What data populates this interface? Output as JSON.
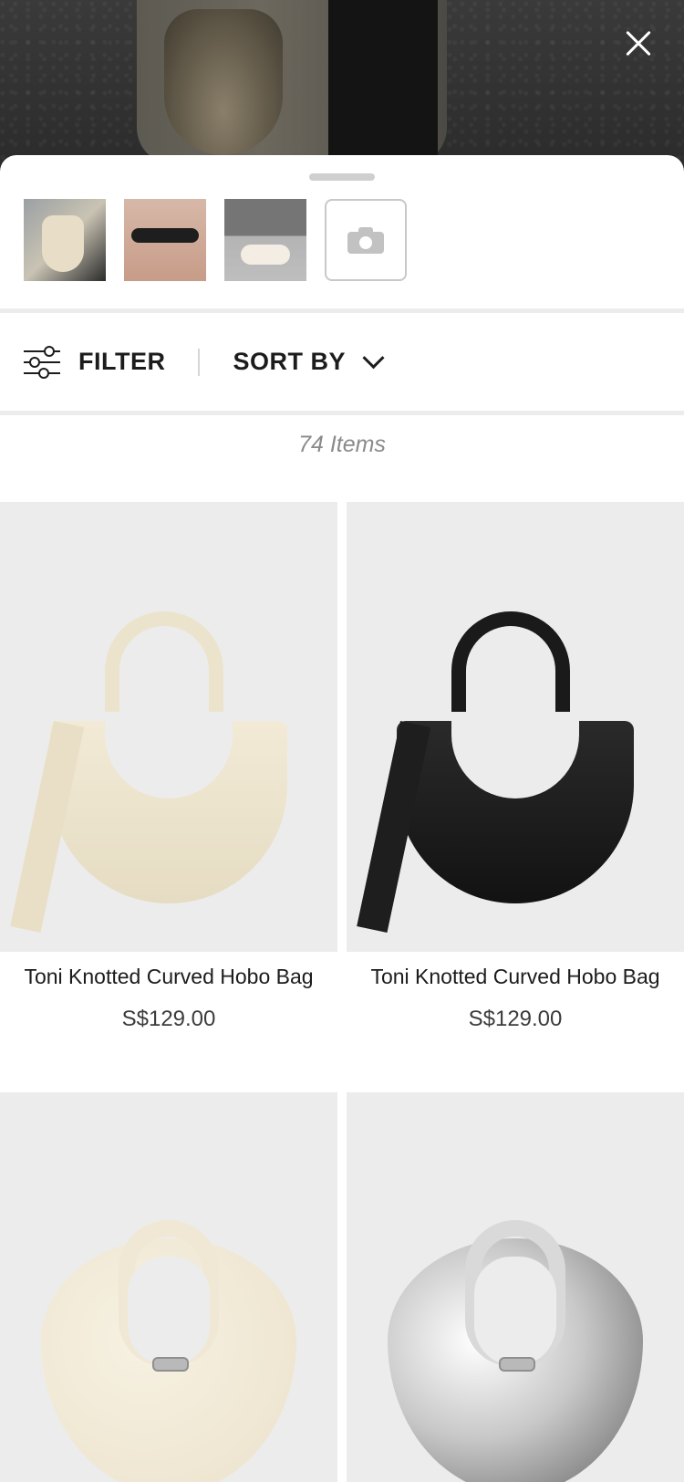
{
  "header": {
    "close_icon": "close-icon"
  },
  "visual_search": {
    "thumbnails": [
      {
        "name": "photo-handbag"
      },
      {
        "name": "photo-sunglasses"
      },
      {
        "name": "photo-sandals"
      }
    ],
    "camera_icon": "camera-icon"
  },
  "toolbar": {
    "filter_label": "FILTER",
    "filter_icon": "sliders-icon",
    "sort_label": "SORT BY",
    "sort_icon": "chevron-down-icon"
  },
  "results": {
    "count_label": "74 Items"
  },
  "products": [
    {
      "name": "Toni Knotted Curved Hobo Bag",
      "price": "S$129.00",
      "color": "#ece3cd"
    },
    {
      "name": "Toni Knotted Curved Hobo Bag",
      "price": "S$129.00",
      "color": "#1a1a1a"
    },
    {
      "name": "",
      "price": "",
      "color": "#f0e8d4"
    },
    {
      "name": "",
      "price": "",
      "color": "#d9d9d9"
    }
  ]
}
